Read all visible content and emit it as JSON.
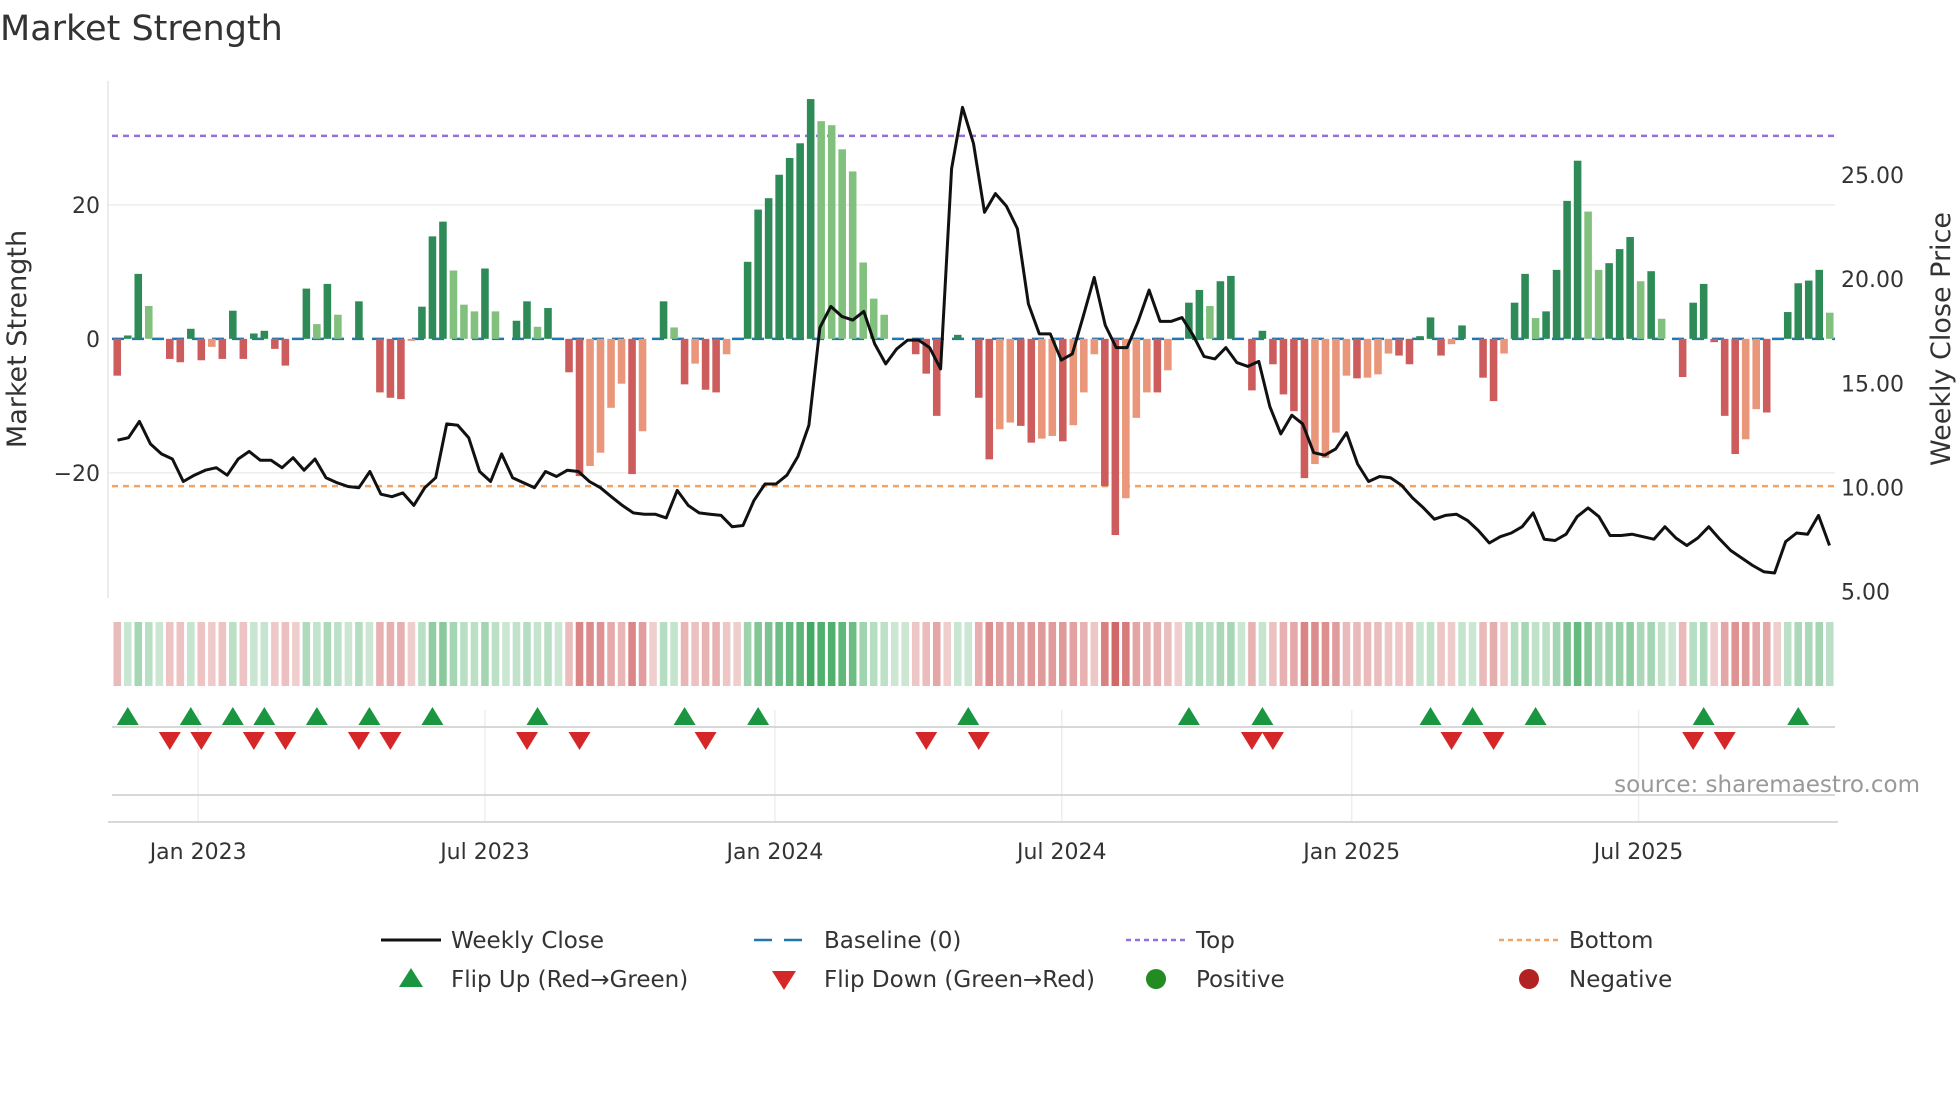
{
  "chart_data": {
    "type": "bar",
    "title": "Market Strength",
    "ylabel": "Market Strength",
    "y2label": "Weekly Close Price",
    "ylim": [
      -38.7,
      38.5
    ],
    "y2lim": [
      4.7,
      29.5
    ],
    "yticks": [
      {
        "value": 20,
        "label": "20"
      },
      {
        "value": 0,
        "label": "0"
      },
      {
        "value": -20,
        "label": "−20"
      }
    ],
    "y2ticks": [
      {
        "value": 25,
        "label": "25.00"
      },
      {
        "value": 20,
        "label": "20.00"
      },
      {
        "value": 15,
        "label": "15.00"
      },
      {
        "value": 10,
        "label": "10.00"
      },
      {
        "value": 5,
        "label": "5.00"
      }
    ],
    "xticks": [
      {
        "index": 8.2,
        "label": "Jan 2023"
      },
      {
        "index": 35.5,
        "label": "Jul 2023"
      },
      {
        "index": 63.1,
        "label": "Jan 2024"
      },
      {
        "index": 90.4,
        "label": "Jul 2024"
      },
      {
        "index": 118.0,
        "label": "Jan 2025"
      },
      {
        "index": 145.3,
        "label": "Jul 2025"
      }
    ],
    "top_level": 30.3,
    "bottom_level": -22,
    "strength": [
      -5.5,
      0.5,
      9.7,
      4.9,
      0,
      -3,
      -3.5,
      1.5,
      -3.2,
      -1.2,
      -3,
      4.2,
      -3,
      0.8,
      1.2,
      -1.5,
      -4,
      0,
      7.5,
      2.2,
      8.2,
      3.6,
      0,
      5.6,
      0,
      -8,
      -8.8,
      -9,
      -0.3,
      4.8,
      15.3,
      17.5,
      10.2,
      5.1,
      4.1,
      10.5,
      4.1,
      0,
      2.7,
      5.6,
      1.8,
      4.6,
      0,
      -5,
      -20.5,
      -19,
      -17,
      -10.3,
      -6.7,
      -20.2,
      -13.8,
      0,
      5.6,
      1.7,
      -6.8,
      -3.7,
      -7.6,
      -8,
      -2.3,
      0,
      11.5,
      19.3,
      21,
      24.5,
      27,
      29.2,
      35.8,
      32.5,
      31.9,
      28.3,
      25,
      11.4,
      6,
      3.6,
      0,
      0,
      -2.3,
      -5.2,
      -11.5,
      0,
      0.6,
      0,
      -8.8,
      -18,
      -13.5,
      -12.5,
      -13,
      -15.5,
      -14.9,
      -14.5,
      -15.3,
      -12.9,
      -8,
      -2.3,
      -22,
      -29.3,
      -23.8,
      -11.8,
      -8,
      -8,
      -4.7,
      0,
      5.4,
      7.3,
      4.9,
      8.6,
      9.4,
      0,
      -7.7,
      1.2,
      -3.8,
      -8.3,
      -10.8,
      -20.8,
      -18.7,
      -17.8,
      -14,
      -5.5,
      -5.9,
      -5.8,
      -5.3,
      -2.2,
      -2.5,
      -3.8,
      0.4,
      3.2,
      -2.5,
      -0.8,
      2,
      0,
      -5.8,
      -9.3,
      -2.2,
      5.4,
      9.7,
      3.1,
      4.1,
      10.3,
      20.6,
      26.6,
      19,
      10.3,
      11.3,
      13.4,
      15.2,
      8.6,
      10.1,
      3,
      0,
      -5.7,
      5.4,
      8.2,
      -0.5,
      -11.5,
      -17.2,
      -15,
      -10.5,
      -11,
      0,
      4,
      8.3,
      8.7,
      10.3,
      3.9
    ],
    "weekly_close": [
      12.27,
      12.39,
      13.17,
      12.09,
      11.61,
      11.37,
      10.29,
      10.59,
      10.83,
      10.95,
      10.59,
      11.37,
      11.73,
      11.31,
      11.31,
      10.95,
      11.43,
      10.83,
      11.37,
      10.47,
      10.23,
      10.05,
      9.99,
      10.77,
      9.68,
      9.56,
      9.74,
      9.14,
      9.99,
      10.47,
      13.05,
      12.99,
      12.39,
      10.77,
      10.29,
      11.61,
      10.47,
      10.23,
      9.99,
      10.77,
      10.53,
      10.83,
      10.77,
      10.29,
      9.99,
      9.56,
      9.14,
      8.78,
      8.72,
      8.72,
      8.54,
      9.86,
      9.14,
      8.78,
      8.72,
      8.66,
      8.12,
      8.18,
      9.38,
      10.17,
      10.17,
      10.59,
      11.49,
      12.99,
      17.67,
      18.69,
      18.21,
      18.03,
      18.45,
      16.89,
      15.93,
      16.65,
      17.07,
      17.07,
      16.71,
      15.69,
      25.3,
      28.24,
      26.5,
      23.2,
      24.1,
      23.5,
      22.42,
      18.81,
      17.37,
      17.37,
      16.11,
      16.41,
      18.21,
      20.08,
      17.79,
      16.71,
      16.71,
      17.97,
      19.47,
      17.97,
      17.97,
      18.15,
      17.31,
      16.29,
      16.17,
      16.71,
      15.99,
      15.81,
      16.05,
      13.89,
      12.57,
      13.47,
      13.05,
      11.67,
      11.55,
      11.85,
      12.63,
      11.13,
      10.29,
      10.53,
      10.47,
      10.11,
      9.5,
      9.02,
      8.48,
      8.66,
      8.72,
      8.42,
      7.94,
      7.34,
      7.64,
      7.82,
      8.12,
      8.78,
      7.52,
      7.46,
      7.76,
      8.6,
      9.02,
      8.6,
      7.7,
      7.7,
      7.76,
      7.64,
      7.52,
      8.12,
      7.58,
      7.22,
      7.58,
      8.12,
      7.52,
      6.98,
      6.62,
      6.26,
      5.96,
      5.9,
      7.4,
      7.82,
      7.76,
      8.66,
      7.22
    ],
    "flip_up_indices": [
      1,
      7,
      11,
      14,
      19,
      24,
      30,
      40,
      54,
      61,
      81,
      102,
      109,
      125,
      129,
      135,
      151,
      160
    ],
    "flip_down_indices": [
      5,
      8,
      13,
      16,
      23,
      26,
      39,
      44,
      56,
      77,
      82,
      108,
      110,
      127,
      131,
      150,
      153
    ],
    "legend_placement": "bottom",
    "legend": [
      {
        "key": "weekly_close",
        "label": "Weekly Close"
      },
      {
        "key": "baseline",
        "label": "Baseline (0)"
      },
      {
        "key": "top",
        "label": "Top"
      },
      {
        "key": "bottom",
        "label": "Bottom"
      },
      {
        "key": "flip_up",
        "label": "Flip Up (Red→Green)"
      },
      {
        "key": "flip_down",
        "label": "Flip Down (Green→Red)"
      },
      {
        "key": "positive",
        "label": "Positive"
      },
      {
        "key": "negative",
        "label": "Negative"
      }
    ],
    "source": "source: sharemaestro.com"
  },
  "colors": {
    "pos_strong": "#2e8b57",
    "pos_weak": "#82c07e",
    "neg_strong": "#cd5c5c",
    "neg_weak": "#e9967a",
    "baseline": "#1f77b4",
    "top": "#9370db",
    "bottom": "#f4a460",
    "flip_up": "#1a9641",
    "flip_down": "#d62728",
    "positive": "#228b22",
    "negative": "#b22222",
    "close": "#111111"
  }
}
